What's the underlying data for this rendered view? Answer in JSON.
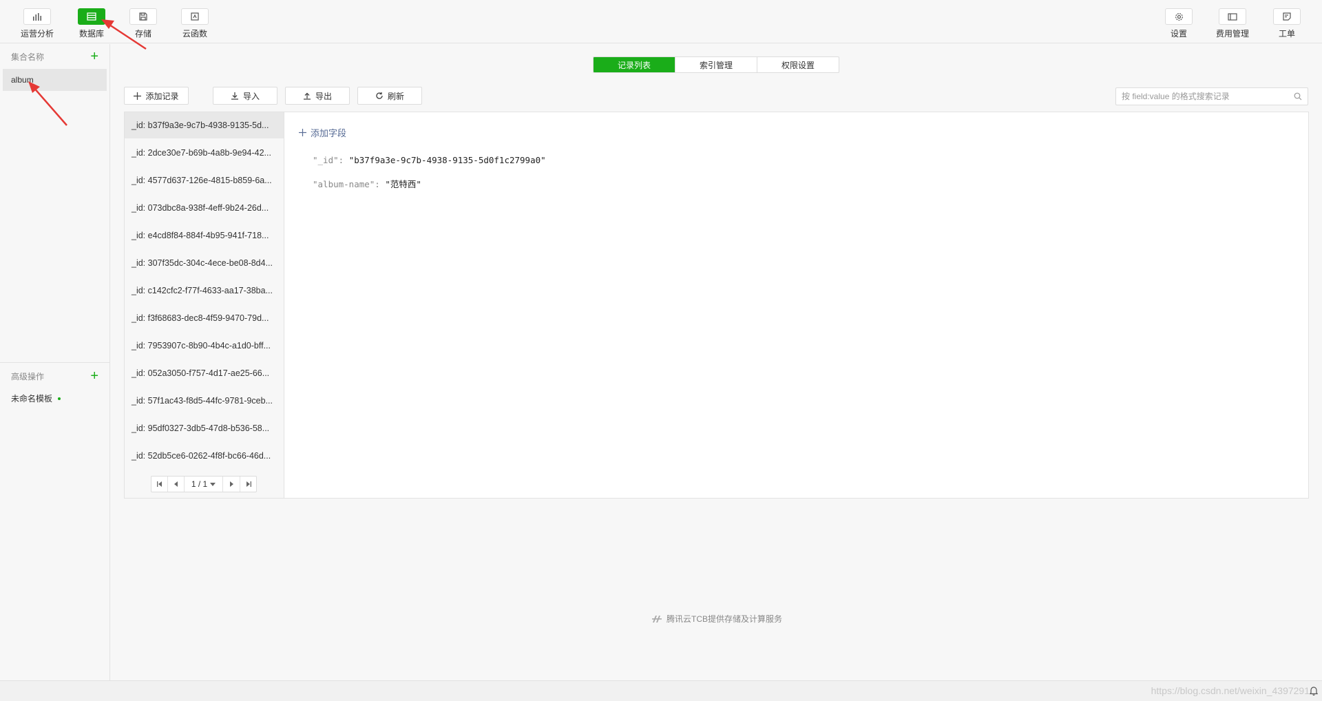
{
  "toolbar": {
    "left": [
      {
        "label": "运营分析",
        "icon": "bar-chart-icon",
        "active": false
      },
      {
        "label": "数据库",
        "icon": "database-icon",
        "active": true
      },
      {
        "label": "存储",
        "icon": "save-icon",
        "active": false
      },
      {
        "label": "云函数",
        "icon": "function-icon",
        "active": false
      }
    ],
    "right": [
      {
        "label": "设置",
        "icon": "gear-icon"
      },
      {
        "label": "费用管理",
        "icon": "billing-icon"
      },
      {
        "label": "工单",
        "icon": "ticket-icon"
      }
    ]
  },
  "sidebar": {
    "collections_title": "集合名称",
    "collections": [
      "album"
    ],
    "advanced_title": "高级操作",
    "templates": [
      "未命名模板"
    ]
  },
  "tabs": [
    {
      "label": "记录列表",
      "active": true
    },
    {
      "label": "索引管理",
      "active": false
    },
    {
      "label": "权限设置",
      "active": false
    }
  ],
  "actions": {
    "add_record": "添加记录",
    "import": "导入",
    "export": "导出",
    "refresh": "刷新"
  },
  "search": {
    "placeholder": "按 field:value 的格式搜索记录"
  },
  "records": [
    "_id: b37f9a3e-9c7b-4938-9135-5d...",
    "_id: 2dce30e7-b69b-4a8b-9e94-42...",
    "_id: 4577d637-126e-4815-b859-6a...",
    "_id: 073dbc8a-938f-4eff-9b24-26d...",
    "_id: e4cd8f84-884f-4b95-941f-718...",
    "_id: 307f35dc-304c-4ece-be08-8d4...",
    "_id: c142cfc2-f77f-4633-aa17-38ba...",
    "_id: f3f68683-dec8-4f59-9470-79d...",
    "_id: 7953907c-8b90-4b4c-a1d0-bff...",
    "_id: 052a3050-f757-4d17-ae25-66...",
    "_id: 57f1ac43-f8d5-44fc-9781-9ceb...",
    "_id: 95df0327-3db5-47d8-b536-58...",
    "_id: 52db5ce6-0262-4f8f-bc66-46d..."
  ],
  "pager": {
    "text": "1 / 1"
  },
  "detail": {
    "add_field": "添加字段",
    "fields": [
      {
        "key": "\"_id\":",
        "value": "\"b37f9a3e-9c7b-4938-9135-5d0f1c2799a0\""
      },
      {
        "key": "\"album-name\":",
        "value": "\"范特西\""
      }
    ]
  },
  "footer": {
    "brand": "腾讯云TCB提供存储及计算服务"
  },
  "watermark": "https://blog.csdn.net/weixin_4397291",
  "colors": {
    "accent": "#1aad19",
    "annotation": "#e53935",
    "link": "#576b95"
  }
}
